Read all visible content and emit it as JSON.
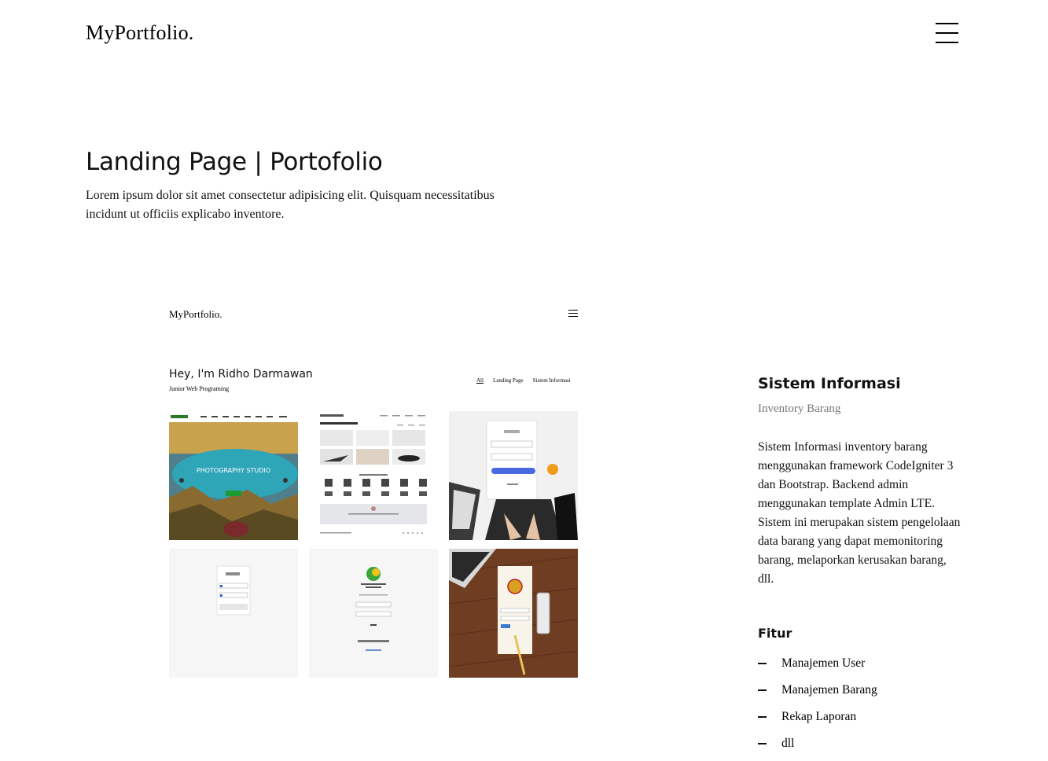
{
  "header": {
    "brand": "MyPortfolio.",
    "menu_icon": "hamburger-icon"
  },
  "project": {
    "title": "Landing Page | Portofolio",
    "description": "Lorem ipsum dolor sit amet consectetur adipisicing elit. Quisquam necessitatibus incidunt ut officiis explicabo inventore."
  },
  "preview": {
    "brand": "MyPortfolio.",
    "greeting": "Hey, I'm Ridho Darmawan",
    "role": "Junior Web Programing",
    "filters": [
      "All",
      "Landing Page",
      "Sistem Informasi"
    ],
    "thumb1_caption": "PHOTOGRAPHY STUDIO"
  },
  "details": {
    "title": "Sistem Informasi",
    "subtitle": "Inventory Barang",
    "description": "Sistem Informasi inventory barang menggunakan framework CodeIgniter 3 dan Bootstrap. Backend admin menggunakan template Admin LTE. Sistem ini merupakan sistem pengelolaan data barang yang dapat memonitoring barang, melaporkan kerusakan barang, dll.",
    "features_title": "Fitur",
    "features": [
      "Manajemen User",
      "Manajemen Barang",
      "Rekap Laporan",
      "dll"
    ]
  }
}
